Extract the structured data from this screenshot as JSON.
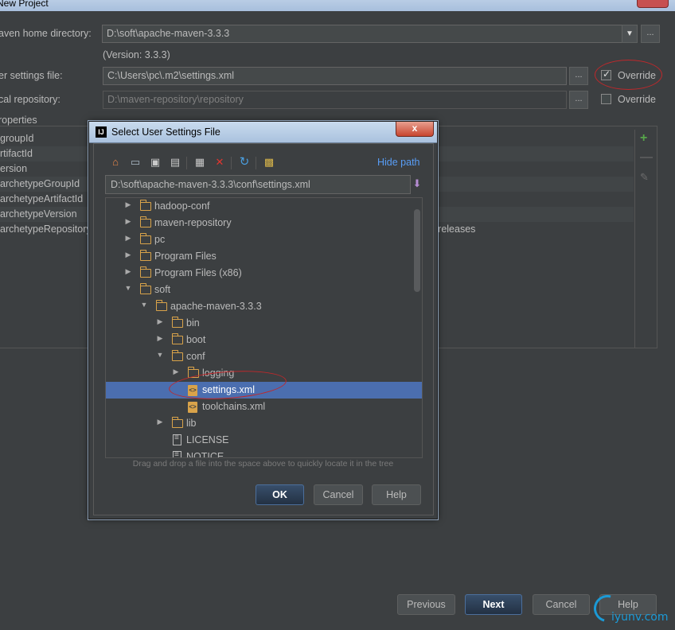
{
  "window": {
    "title": "New Project"
  },
  "form": {
    "maven_home_label": "aven home directory:",
    "maven_home_value": "D:\\soft\\apache-maven-3.3.3",
    "version_text": "(Version: 3.3.3)",
    "settings_label": "er settings file:",
    "settings_value": "C:\\Users\\pc\\.m2\\settings.xml",
    "override_settings_label": "Override",
    "override_settings_checked": true,
    "local_repo_label": "cal repository:",
    "local_repo_value": "D:\\maven-repository\\repository",
    "override_repo_label": "Override",
    "override_repo_checked": false,
    "browse_label": "..."
  },
  "properties": {
    "header": "roperties",
    "rows": [
      {
        "key": "groupId",
        "value": ""
      },
      {
        "key": "rtifactId",
        "value": ""
      },
      {
        "key": "ersion",
        "value": ""
      },
      {
        "key": "archetypeGroupId",
        "value": ""
      },
      {
        "key": "archetypeArtifactId",
        "value": ""
      },
      {
        "key": "archetypeVersion",
        "value": ""
      },
      {
        "key": "archetypeRepository",
        "value": "-releases"
      }
    ],
    "add_icon": "plus-icon",
    "remove_icon": "minus-icon",
    "edit_icon": "pencil-icon"
  },
  "footer": {
    "previous": "Previous",
    "next": "Next",
    "cancel": "Cancel",
    "help": "Help"
  },
  "dialog": {
    "title": "Select User Settings File",
    "logo": "IJ",
    "close": "x",
    "hide_path": "Hide path",
    "path": "D:\\soft\\apache-maven-3.3.3\\conf\\settings.xml",
    "hint": "Drag and drop a file into the space above to quickly locate it in the tree",
    "ok": "OK",
    "cancel": "Cancel",
    "help": "Help",
    "toolbar": [
      "home-icon",
      "desktop-icon",
      "project-folder-icon",
      "module-folder-icon",
      "new-folder-icon",
      "delete-icon",
      "refresh-icon",
      "show-hidden-icon"
    ],
    "tree": [
      {
        "name": "hadoop-conf",
        "depth": 0,
        "kind": "folder",
        "expanded": false
      },
      {
        "name": "maven-repository",
        "depth": 0,
        "kind": "folder",
        "expanded": false
      },
      {
        "name": "pc",
        "depth": 0,
        "kind": "folder",
        "expanded": false
      },
      {
        "name": "Program Files",
        "depth": 0,
        "kind": "folder",
        "expanded": false
      },
      {
        "name": "Program Files (x86)",
        "depth": 0,
        "kind": "folder",
        "expanded": false
      },
      {
        "name": "soft",
        "depth": 0,
        "kind": "folder",
        "expanded": true
      },
      {
        "name": "apache-maven-3.3.3",
        "depth": 1,
        "kind": "folder",
        "expanded": true
      },
      {
        "name": "bin",
        "depth": 2,
        "kind": "folder",
        "expanded": false
      },
      {
        "name": "boot",
        "depth": 2,
        "kind": "folder",
        "expanded": false
      },
      {
        "name": "conf",
        "depth": 2,
        "kind": "folder",
        "expanded": true
      },
      {
        "name": "logging",
        "depth": 3,
        "kind": "folder",
        "expanded": false
      },
      {
        "name": "settings.xml",
        "depth": 3,
        "kind": "xml",
        "selected": true
      },
      {
        "name": "toolchains.xml",
        "depth": 3,
        "kind": "xml"
      },
      {
        "name": "lib",
        "depth": 2,
        "kind": "folder",
        "expanded": false
      },
      {
        "name": "LICENSE",
        "depth": 2,
        "kind": "file"
      },
      {
        "name": "NOTICE",
        "depth": 2,
        "kind": "file"
      }
    ]
  },
  "watermark": {
    "text": "iyunv.com"
  }
}
